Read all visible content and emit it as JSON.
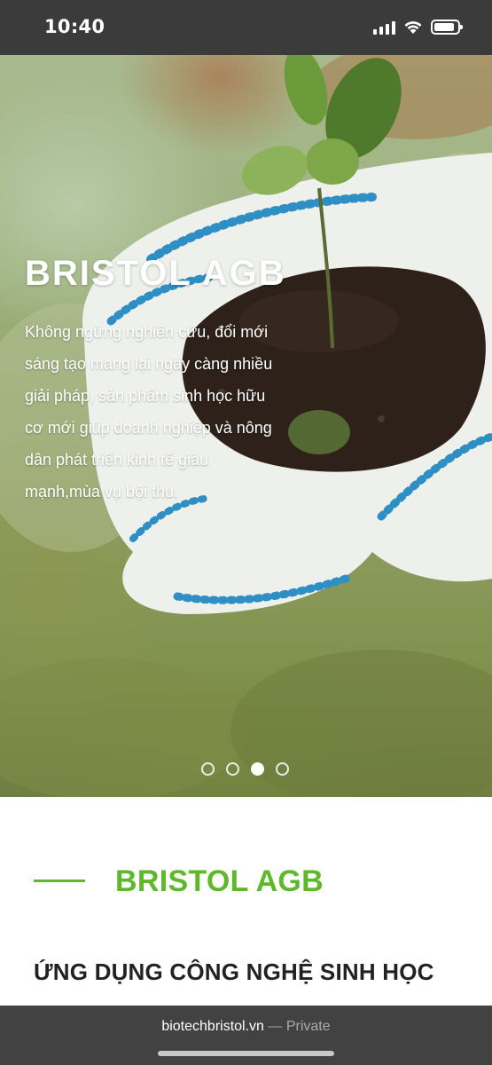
{
  "status_bar": {
    "time": "10:40",
    "icons": [
      "cellular-signal-icon",
      "wifi-icon",
      "battery-icon"
    ]
  },
  "hero": {
    "title": "BRISTOL AGB",
    "description": "Không ngừng nghiên cứu, đổi mới sáng tạo mang lại ngày càng nhiều giải pháp, sản phẩm sinh học hữu cơ mới giúp doanh nghiệp và nông dân phát triển kinh tế giàu mạnh,mùa vụ bội thu.",
    "slides_total": 4,
    "active_slide": 3
  },
  "section": {
    "title": "BRISTOL AGB",
    "subtitle": "ỨNG DỤNG CÔNG NGHỆ SINH HỌC",
    "accent_color": "#5fb82b"
  },
  "browser": {
    "domain": "biotechbristol.vn",
    "mode": "— Private"
  }
}
